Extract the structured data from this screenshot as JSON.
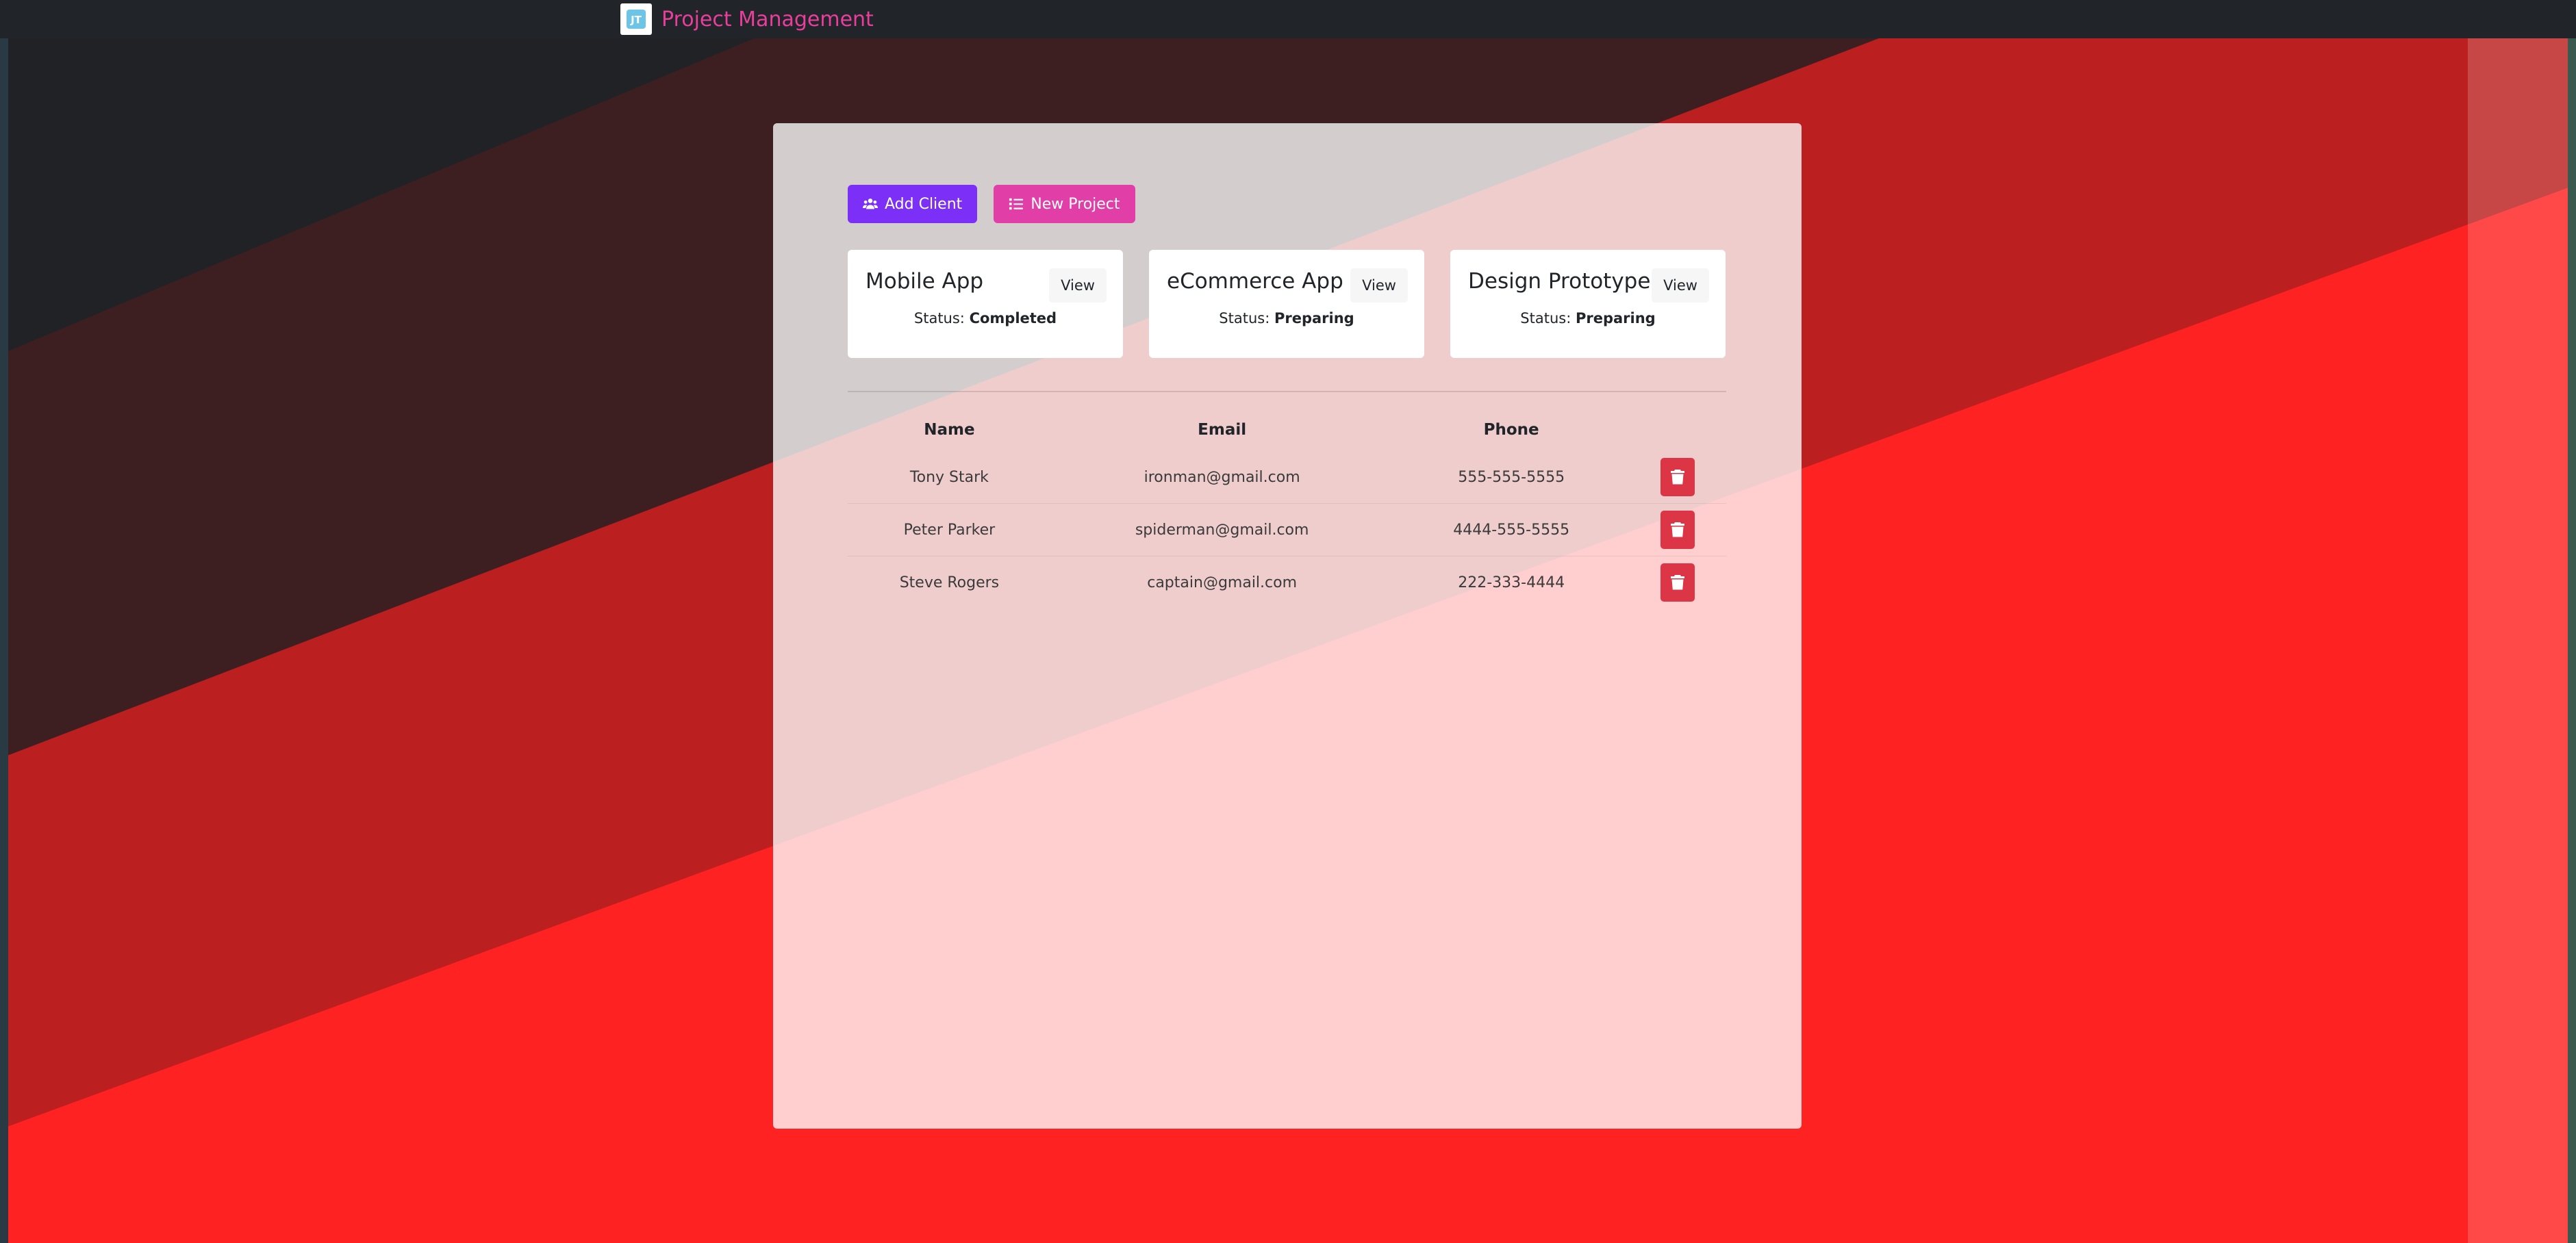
{
  "navbar": {
    "brand_name": "Project Management",
    "logo_icon": "app-logo-icon"
  },
  "actions": {
    "add_client_label": "Add Client",
    "add_client_icon": "users-icon",
    "new_project_label": "New Project",
    "new_project_icon": "list-icon"
  },
  "projects": [
    {
      "name": "Mobile App",
      "view_label": "View",
      "status_label": "Status:",
      "status": "Completed"
    },
    {
      "name": "eCommerce App",
      "view_label": "View",
      "status_label": "Status:",
      "status": "Preparing"
    },
    {
      "name": "Design Prototype 1",
      "view_label": "View",
      "status_label": "Status:",
      "status": "Preparing"
    }
  ],
  "clients_table": {
    "headers": [
      "Name",
      "Email",
      "Phone"
    ],
    "rows": [
      {
        "name": "Tony Stark",
        "email": "ironman@gmail.com",
        "phone": "555-555-5555"
      },
      {
        "name": "Peter Parker",
        "email": "spiderman@gmail.com",
        "phone": "4444-555-5555"
      },
      {
        "name": "Steve Rogers",
        "email": "captain@gmail.com",
        "phone": "222-333-4444"
      }
    ],
    "delete_icon": "trash-icon"
  },
  "colors": {
    "navbar_bg": "#212529",
    "brand_text": "#e83e9c",
    "add_client_btn": "#7b2ff7",
    "new_project_btn": "#e13fa7",
    "delete_btn": "#dc3545",
    "background_red": "#ff2222",
    "background_dark_red": "#bb1f1f",
    "background_dark": "#212226"
  }
}
